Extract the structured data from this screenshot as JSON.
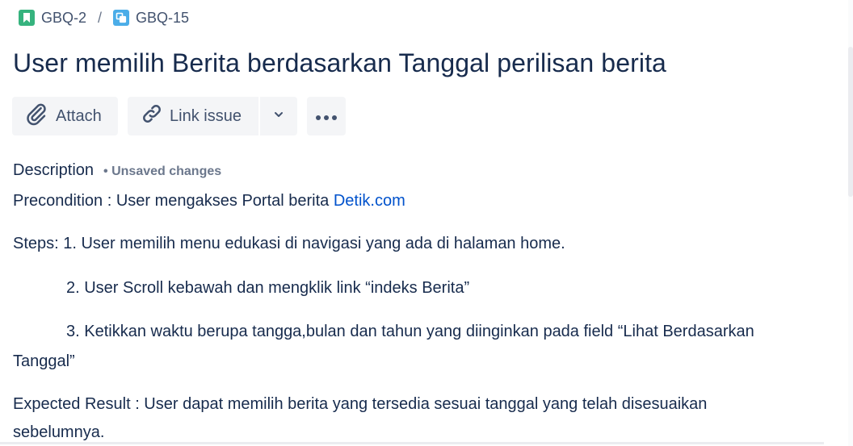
{
  "breadcrumb": {
    "items": [
      {
        "label": "GBQ-2",
        "icon": "story-bookmark-icon",
        "color": "#36b37e"
      },
      {
        "label": "GBQ-15",
        "icon": "subtask-icon",
        "color": "#4bade8"
      }
    ],
    "separator": "/"
  },
  "issue": {
    "title": "User memilih Berita berdasarkan Tanggal perilisan berita"
  },
  "toolbar": {
    "attach_label": "Attach",
    "attach_icon": "paperclip-icon",
    "link_issue_label": "Link issue",
    "link_issue_icon": "link-icon",
    "dropdown_icon": "chevron-down-icon",
    "more_icon": "ellipsis-icon"
  },
  "description": {
    "label": "Description",
    "status": "• Unsaved changes",
    "precondition_prefix": "Precondition : User mengakses Portal berita ",
    "precondition_link": "Detik.com",
    "steps_1": "Steps:  1. User memilih menu edukasi di navigasi yang ada di halaman home.",
    "steps_2": "2.  User Scroll kebawah dan mengklik link “indeks Berita”",
    "steps_3a": "3. Ketikkan waktu berupa tangga,bulan dan tahun yang diinginkan pada field “Lihat Berdasarkan",
    "steps_3b": "Tanggal”",
    "expected_a": "Expected Result : User dapat memilih berita yang tersedia sesuai tanggal yang telah disesuaikan",
    "expected_b": "sebelumnya."
  },
  "colors": {
    "link": "#0052cc",
    "text": "#172b4d",
    "button_bg": "#f4f5f7",
    "muted": "#6b778c"
  }
}
